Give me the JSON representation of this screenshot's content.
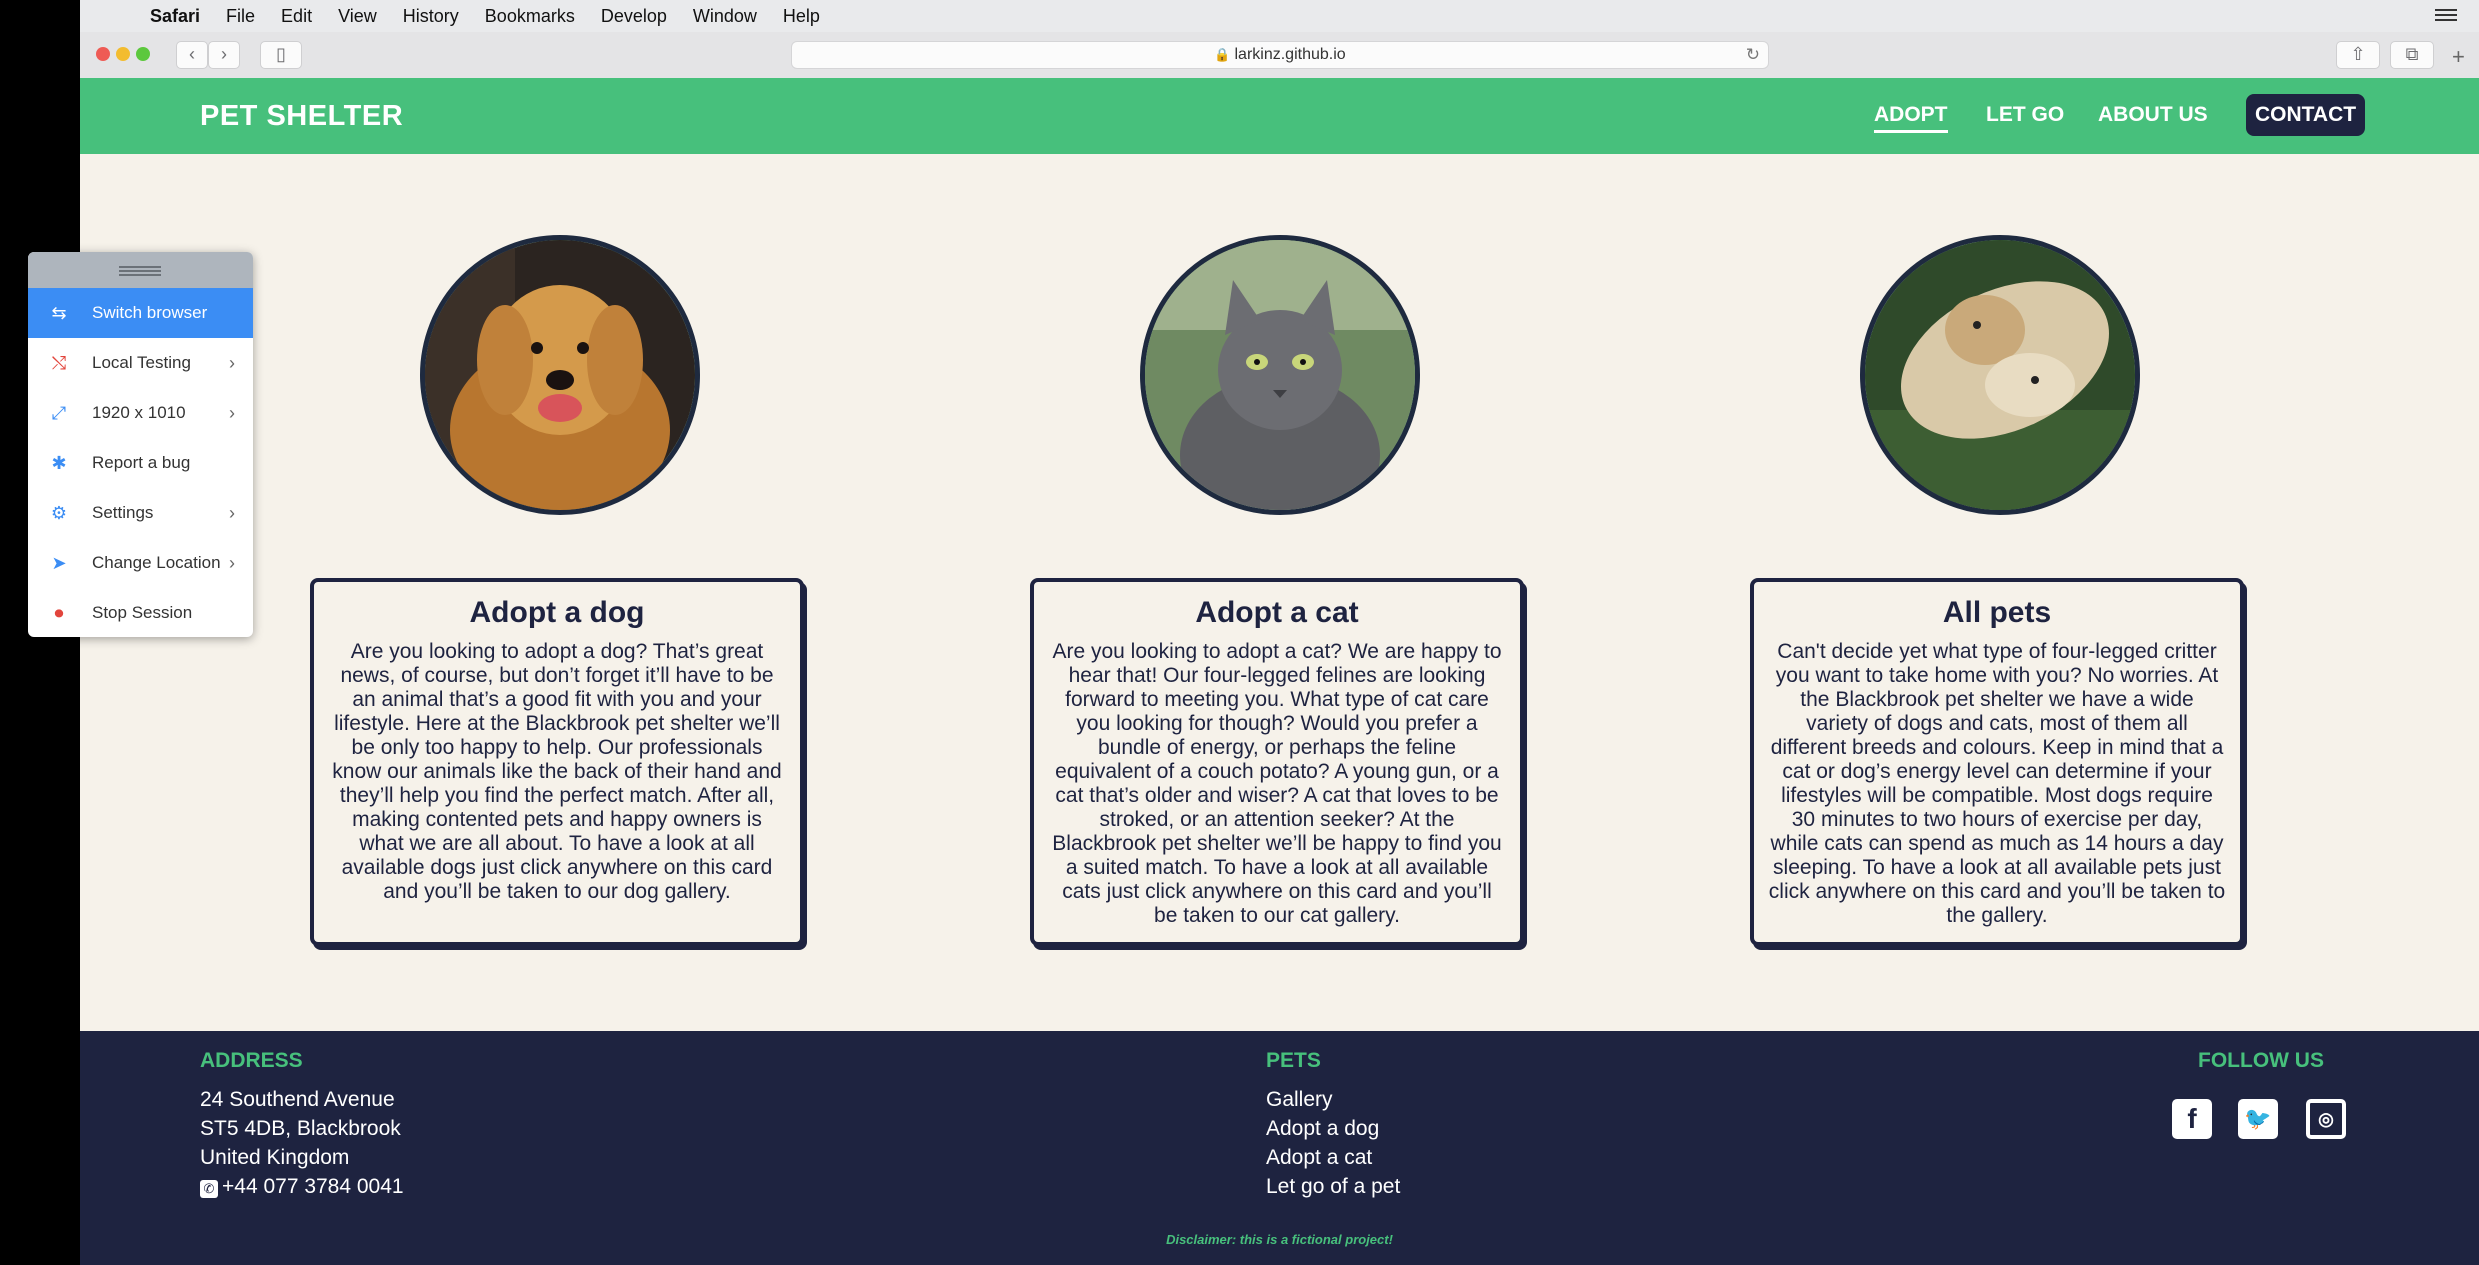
{
  "menubar": {
    "apple": "",
    "items": [
      "Safari",
      "File",
      "Edit",
      "View",
      "History",
      "Bookmarks",
      "Develop",
      "Window",
      "Help"
    ]
  },
  "browser": {
    "url": "larkinz.github.io"
  },
  "site": {
    "brand": "PET SHELTER",
    "nav": [
      "ADOPT",
      "LET GO",
      "ABOUT US",
      "CONTACT"
    ]
  },
  "cards": [
    {
      "title": "Adopt a dog",
      "text": "Are you looking to adopt a dog? That’s great news, of course, but don’t forget it’ll have to be an animal that’s a good fit with you and your lifestyle. Here at the Blackbrook pet shelter we’ll be only too happy to help. Our professionals know our animals like the back of their hand and they’ll help you find the perfect match. After all, making contented pets and happy owners is what we are all about. To have a look at all available dogs just click anywhere on this card and you’ll be taken to our dog gallery."
    },
    {
      "title": "Adopt a cat",
      "text": "Are you looking to adopt a cat? We are happy to hear that! Our four-legged felines are looking forward to meeting you. What type of cat care you looking for though? Would you prefer a bundle of energy, or perhaps the feline equivalent of a couch potato? A young gun, or a cat that’s older and wiser? A cat that loves to be stroked, or an attention seeker? At the Blackbrook pet shelter we’ll be happy to find you a suited match. To have a look at all available cats just click anywhere on this card and you’ll be taken to our cat gallery."
    },
    {
      "title": "All pets",
      "text": "Can't decide yet what type of four-legged critter you want to take home with you? No worries. At the Blackbrook pet shelter we have a wide variety of dogs and cats, most of them all different breeds and colours. Keep in mind that a cat or dog’s energy level can determine if your lifestyles will be compatible. Most dogs require 30 minutes to two hours of exercise per day, while cats can spend as much as 14 hours a day sleeping. To have a look at all available pets just click anywhere on this card and you’ll be taken to the gallery."
    }
  ],
  "footer": {
    "address_heading": "ADDRESS",
    "address_lines": [
      "24 Southend Avenue",
      "ST5 4DB, Blackbrook",
      "United Kingdom"
    ],
    "phone": "+44 077 3784 0041",
    "pets_heading": "PETS",
    "pets_links": [
      "Gallery",
      "Adopt a dog",
      "Adopt a cat",
      "Let go of a pet"
    ],
    "follow_heading": "FOLLOW US",
    "disclaimer": "Disclaimer: this is a fictional project!"
  },
  "bs_panel": {
    "items": [
      {
        "label": "Switch browser",
        "icon": "switch-icon"
      },
      {
        "label": "Local Testing",
        "icon": "local-testing-icon"
      },
      {
        "label": "1920 x 1010",
        "icon": "resize-icon"
      },
      {
        "label": "Report a bug",
        "icon": "bug-icon"
      },
      {
        "label": "Settings",
        "icon": "gear-icon"
      },
      {
        "label": "Change Location",
        "icon": "location-icon"
      },
      {
        "label": "Stop Session",
        "icon": "stop-icon"
      }
    ]
  },
  "colors": {
    "brand_green": "#47c07c",
    "navy": "#1e2340",
    "page_bg": "#f6f2ea",
    "panel_active": "#3b8df4"
  }
}
